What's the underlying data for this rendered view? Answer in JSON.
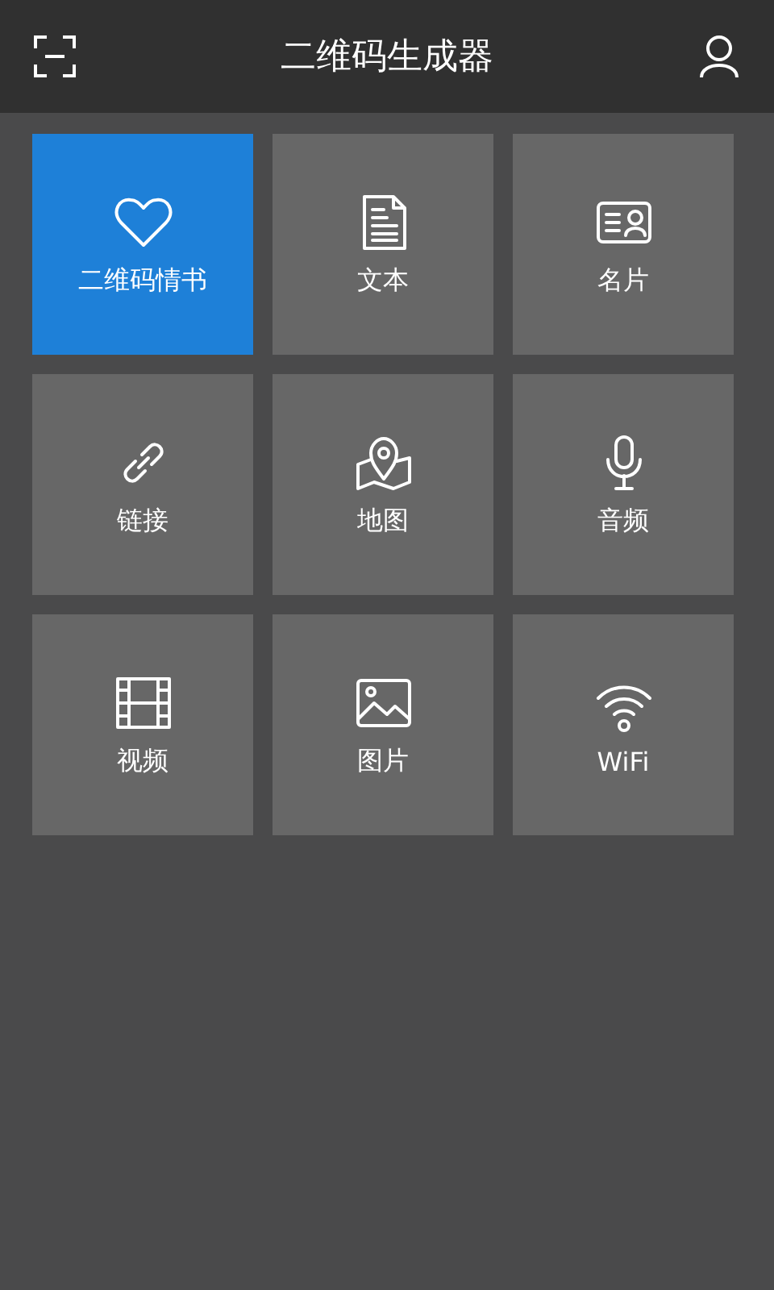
{
  "header": {
    "title": "二维码生成器"
  },
  "tiles": [
    {
      "label": "二维码情书",
      "kind": "heart",
      "selected": true
    },
    {
      "label": "文本",
      "kind": "document",
      "selected": false
    },
    {
      "label": "名片",
      "kind": "card",
      "selected": false
    },
    {
      "label": "链接",
      "kind": "link",
      "selected": false
    },
    {
      "label": "地图",
      "kind": "map",
      "selected": false
    },
    {
      "label": "音频",
      "kind": "mic",
      "selected": false
    },
    {
      "label": "视频",
      "kind": "film",
      "selected": false
    },
    {
      "label": "图片",
      "kind": "image",
      "selected": false
    },
    {
      "label": "WiFi",
      "kind": "wifi",
      "selected": false
    }
  ]
}
